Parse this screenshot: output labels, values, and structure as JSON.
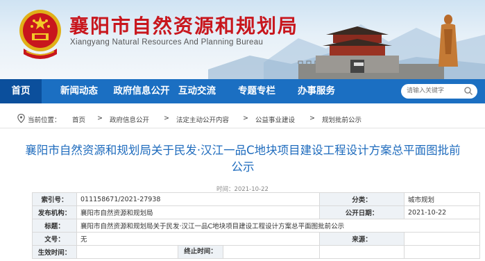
{
  "header": {
    "title": "襄阳市自然资源和规划局",
    "subtitle": "Xiangyang Natural Resources And Planning Bureau",
    "emblem_icon": "national-emblem-icon",
    "brand_red": "#c8161d"
  },
  "nav": {
    "items": [
      {
        "label": "首页",
        "active": true
      },
      {
        "label": "新闻动态"
      },
      {
        "label": "政府信息公开"
      },
      {
        "label": "互动交流"
      },
      {
        "label": "专题专栏"
      },
      {
        "label": "办事服务"
      }
    ],
    "color": "#1b6fc2",
    "active_color": "#0b4f9c"
  },
  "search": {
    "placeholder": "请输入关键字",
    "icon": "search-icon"
  },
  "breadcrumb": {
    "prefix": "当前位置：",
    "separator": ">",
    "items": [
      "首页",
      "政府信息公开",
      "法定主动公开内容",
      "公益事业建设",
      "规划批前公示"
    ]
  },
  "article": {
    "title_line1": "襄阳市自然资源和规划局关于民发·汉江一品C地块项目建设工程设计方案总平面图批前",
    "title_line2": "公示",
    "time": "时间：2021-10-22",
    "title_color": "#1e6bbd"
  },
  "meta": {
    "index_label": "索引号：",
    "index_value": "011158671/2021-27938",
    "category_label": "分类：",
    "category_value": "城市规划",
    "publisher_label": "发布机构：",
    "publisher_value": "襄阳市自然资源和规划局",
    "date_label": "公开日期：",
    "date_value": "2021-10-22",
    "subject_label": "标题：",
    "subject_value": "襄阳市自然资源和规划局关于民发·汉江一品C地块项目建设工程设计方案总平面图批前公示",
    "docno_label": "文号：",
    "docno_value": "无",
    "source_label": "来源：",
    "source_value": "",
    "effective_label": "生效时间：",
    "effective_value": "",
    "expire_label": "终止时间：",
    "expire_value": ""
  }
}
